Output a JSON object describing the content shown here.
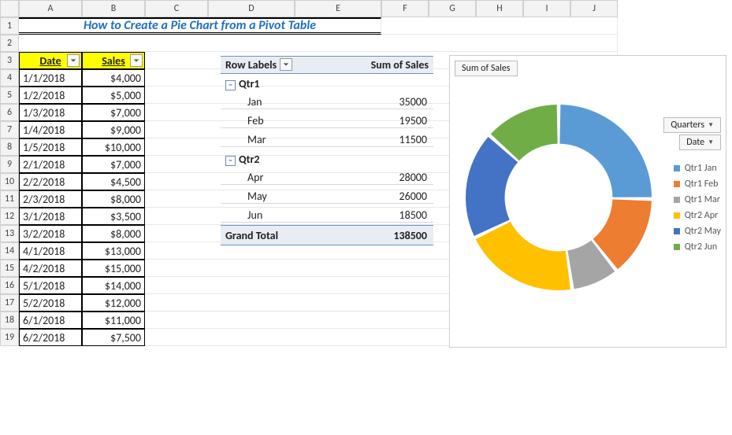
{
  "title": "How to Create a Pie Chart from a Pivot Table",
  "columns": [
    "A",
    "B",
    "C",
    "D",
    "E",
    "F",
    "G",
    "H",
    "I",
    "J"
  ],
  "headers": {
    "date": "Date",
    "sales": "Sales"
  },
  "rows": [
    {
      "n": 4,
      "date": "1/1/2018",
      "sales": "$4,000"
    },
    {
      "n": 5,
      "date": "1/2/2018",
      "sales": "$5,000"
    },
    {
      "n": 6,
      "date": "1/3/2018",
      "sales": "$7,000"
    },
    {
      "n": 7,
      "date": "1/4/2018",
      "sales": "$9,000"
    },
    {
      "n": 8,
      "date": "1/5/2018",
      "sales": "$10,000"
    },
    {
      "n": 9,
      "date": "2/1/2018",
      "sales": "$7,000"
    },
    {
      "n": 10,
      "date": "2/2/2018",
      "sales": "$4,500"
    },
    {
      "n": 11,
      "date": "2/3/2018",
      "sales": "$8,000"
    },
    {
      "n": 12,
      "date": "3/1/2018",
      "sales": "$3,500"
    },
    {
      "n": 13,
      "date": "3/2/2018",
      "sales": "$8,000"
    },
    {
      "n": 14,
      "date": "4/1/2018",
      "sales": "$13,000"
    },
    {
      "n": 15,
      "date": "4/2/2018",
      "sales": "$15,000"
    },
    {
      "n": 16,
      "date": "5/1/2018",
      "sales": "$14,000"
    },
    {
      "n": 17,
      "date": "5/2/2018",
      "sales": "$12,000"
    },
    {
      "n": 18,
      "date": "6/1/2018",
      "sales": "$11,000"
    },
    {
      "n": 19,
      "date": "6/2/2018",
      "sales": "$7,500"
    }
  ],
  "pivot": {
    "row_labels": "Row Labels",
    "sum_sales": "Sum of Sales",
    "groups": [
      {
        "name": "Qtr1",
        "items": [
          {
            "label": "Jan",
            "value": "35000"
          },
          {
            "label": "Feb",
            "value": "19500"
          },
          {
            "label": "Mar",
            "value": "11500"
          }
        ]
      },
      {
        "name": "Qtr2",
        "items": [
          {
            "label": "Apr",
            "value": "28000"
          },
          {
            "label": "May",
            "value": "26000"
          },
          {
            "label": "Jun",
            "value": "18500"
          }
        ]
      }
    ],
    "grand_label": "Grand Total",
    "grand_value": "138500"
  },
  "chart": {
    "title_btn": "Sum of Sales",
    "field_btns": [
      "Quarters",
      "Date"
    ],
    "legend": [
      {
        "label": "Qtr1 Jan",
        "color": "#5B9BD5"
      },
      {
        "label": "Qtr1 Feb",
        "color": "#ED7D31"
      },
      {
        "label": "Qtr1 Mar",
        "color": "#A5A5A5"
      },
      {
        "label": "Qtr2 Apr",
        "color": "#FFC000"
      },
      {
        "label": "Qtr2 May",
        "color": "#4472C4"
      },
      {
        "label": "Qtr2 Jun",
        "color": "#70AD47"
      }
    ]
  },
  "chart_data": {
    "type": "pie",
    "title": "Sum of Sales",
    "categories": [
      "Qtr1 Jan",
      "Qtr1 Feb",
      "Qtr1 Mar",
      "Qtr2 Apr",
      "Qtr2 May",
      "Qtr2 Jun"
    ],
    "values": [
      35000,
      19500,
      11500,
      28000,
      26000,
      18500
    ],
    "colors": [
      "#5B9BD5",
      "#ED7D31",
      "#A5A5A5",
      "#FFC000",
      "#4472C4",
      "#70AD47"
    ],
    "total": 138500,
    "inner_radius_ratio": 0.58
  }
}
